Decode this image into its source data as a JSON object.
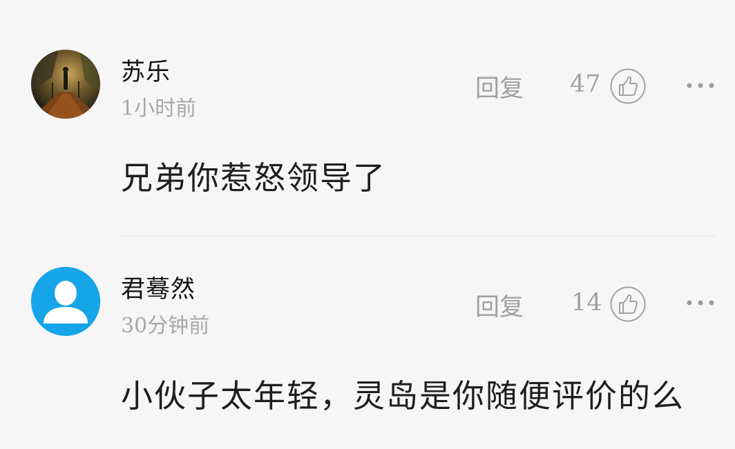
{
  "comments": [
    {
      "username": "苏乐",
      "time": "1小时前",
      "reply_label": "回复",
      "likes": "47",
      "text": "兄弟你惹怒领导了",
      "avatar_icon": "photo-avatar",
      "like_icon": "thumbs-up-icon",
      "more_icon": "more-dots-icon"
    },
    {
      "username": "君蓦然",
      "time": "30分钟前",
      "reply_label": "回复",
      "likes": "14",
      "text": "小伙子太年轻，灵岛是你随便评价的么",
      "avatar_icon": "default-user-avatar",
      "like_icon": "thumbs-up-icon",
      "more_icon": "more-dots-icon"
    }
  ],
  "colors": {
    "background": "#f6f6f7",
    "default_avatar": "#16a5e8",
    "secondary_text": "#a1a1a1",
    "primary_text": "#1e1e1e"
  }
}
